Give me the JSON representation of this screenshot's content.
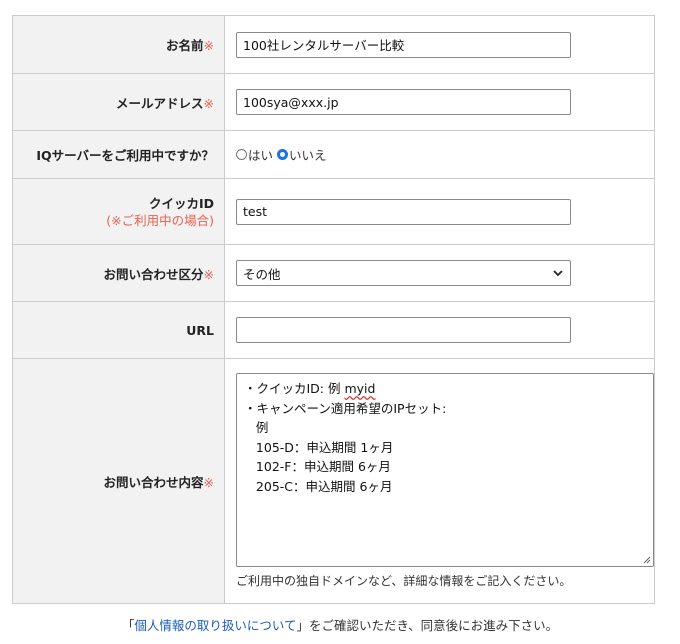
{
  "form": {
    "required_mark": "※",
    "name": {
      "label": "お名前",
      "value": "100社レンタルサーバー比較"
    },
    "email": {
      "label": "メールアドレス",
      "value": "100sya@xxx.jp"
    },
    "iq_user": {
      "label": "IQサーバーをご利用中ですか？",
      "options": [
        {
          "label": "はい",
          "checked": false
        },
        {
          "label": "いいえ",
          "checked": true
        }
      ]
    },
    "quicca_id": {
      "label": "クイッカID",
      "note": "(※ご利用中の場合)",
      "value": "test"
    },
    "category": {
      "label": "お問い合わせ区分",
      "selected": "その他"
    },
    "url": {
      "label": "URL",
      "value": ""
    },
    "inquiry": {
      "label": "お問い合わせ内容",
      "lines": [
        "・クイッカID: 例 ",
        "・キャンペーン適用希望のIPセット:",
        "   例",
        "   105-D：申込期間 1ヶ月",
        "   102-F：申込期間 6ヶ月",
        "   205-C：申込期間 6ヶ月"
      ],
      "first_line_tail": "myid",
      "hint": "ご利用中の独自ドメインなど、詳細な情報をご記入ください。"
    }
  },
  "privacy": {
    "open_bracket": "「",
    "link_text": "個人情報の取り扱いについて",
    "close_text": "」をご確認いただき、同意後にお進み下さい。"
  },
  "colors": {
    "required": "#e8604c",
    "link": "#1a5cb8",
    "label_bg": "#f2f2f2",
    "radio_checked": "#1a73e8"
  }
}
